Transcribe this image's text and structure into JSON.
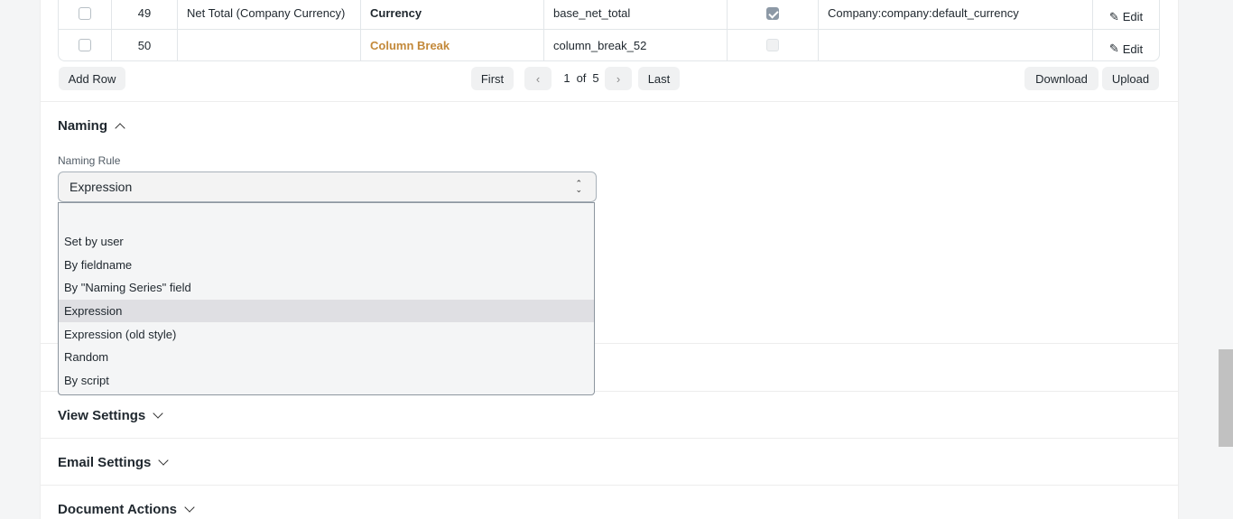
{
  "grid": {
    "rows": [
      {
        "no": "49",
        "label": "Net Total (Company Currency)",
        "type": "Currency",
        "fieldname": "base_net_total",
        "mandatory": true,
        "options": "Company:company:default_currency",
        "edit": "Edit"
      },
      {
        "no": "50",
        "label": "",
        "type": "Column Break",
        "fieldname": "column_break_52",
        "mandatory": false,
        "options": "",
        "edit": "Edit"
      }
    ],
    "add_row": "Add Row",
    "pagination": {
      "first": "First",
      "prev": "‹",
      "current": "1",
      "of": "of",
      "total": "5",
      "next": "›",
      "last": "Last"
    },
    "download": "Download",
    "upload": "Upload"
  },
  "naming": {
    "title": "Naming",
    "field_label": "Naming Rule",
    "selected": "Expression",
    "options": [
      "Set by user",
      "By fieldname",
      "By \"Naming Series\" field",
      "Expression",
      "Expression (old style)",
      "Random",
      "By script"
    ]
  },
  "sections": {
    "view_settings": "View Settings",
    "email_settings": "Email Settings",
    "document_actions": "Document Actions"
  },
  "colors": {
    "column_break": "#c3893a",
    "selected_option_bg": "#dfdfe3"
  }
}
